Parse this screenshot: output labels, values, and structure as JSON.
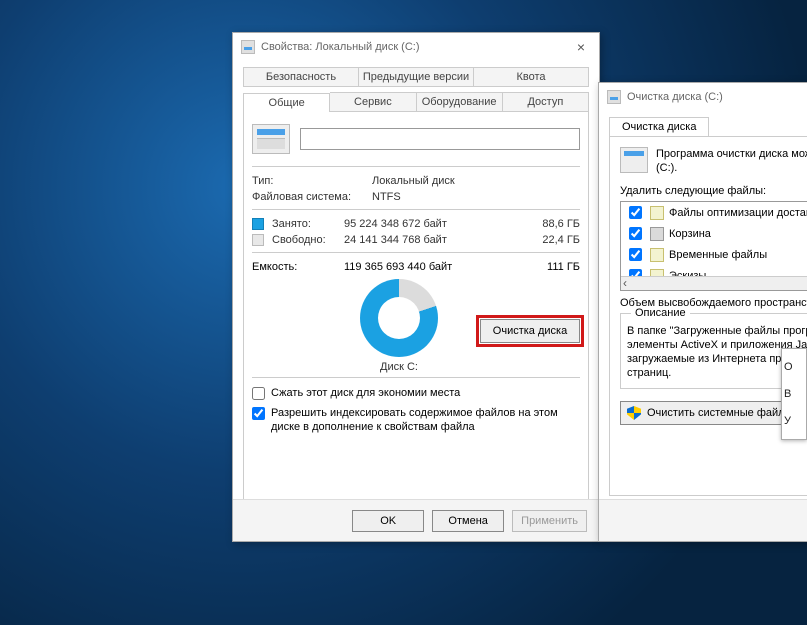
{
  "props": {
    "title": "Свойства: Локальный диск (C:)",
    "tabs_top": {
      "security": "Безопасность",
      "prev": "Предыдущие версии",
      "quota": "Квота"
    },
    "tabs_bottom": {
      "general": "Общие",
      "service": "Сервис",
      "hardware": "Оборудование",
      "access": "Доступ"
    },
    "type_label": "Тип:",
    "type_value": "Локальный диск",
    "fs_label": "Файловая система:",
    "fs_value": "NTFS",
    "used_label": "Занято:",
    "used_bytes": "95 224 348 672 байт",
    "used_gb": "88,6 ГБ",
    "free_label": "Свободно:",
    "free_bytes": "24 141 344 768 байт",
    "free_gb": "22,4 ГБ",
    "cap_label": "Емкость:",
    "cap_bytes": "119 365 693 440 байт",
    "cap_gb": "111 ГБ",
    "disk_caption": "Диск C:",
    "cleanup_btn": "Очистка диска",
    "compress": "Сжать этот диск для экономии места",
    "index": "Разрешить индексировать содержимое файлов на этом диске в дополнение к свойствам файла",
    "ok": "OK",
    "cancel": "Отмена",
    "apply": "Применить"
  },
  "clean": {
    "title": "Очистка диска  (C:)",
    "tab": "Очистка диска",
    "intro": "Программа очистки диска может освободить место на  (C:).",
    "delete_label": "Удалить следующие файлы:",
    "items": [
      {
        "label": "Файлы оптимизации доставки",
        "checked": true,
        "kind": "file"
      },
      {
        "label": "Корзина",
        "checked": true,
        "kind": "bin"
      },
      {
        "label": "Временные файлы",
        "checked": true,
        "kind": "file"
      },
      {
        "label": "Эскизы",
        "checked": true,
        "kind": "file"
      }
    ],
    "freed_label": "Объем высвобождаемого пространства:",
    "desc_title": "Описание",
    "desc_body": "В папке \"Загруженные файлы программ\" сохраняются элементы ActiveX и приложения Java, автоматически загружаемые из Интернета при просмотре некоторых страниц.",
    "sys_btn": "Очистить системные файлы",
    "popup": [
      "О",
      "В",
      "У"
    ]
  }
}
